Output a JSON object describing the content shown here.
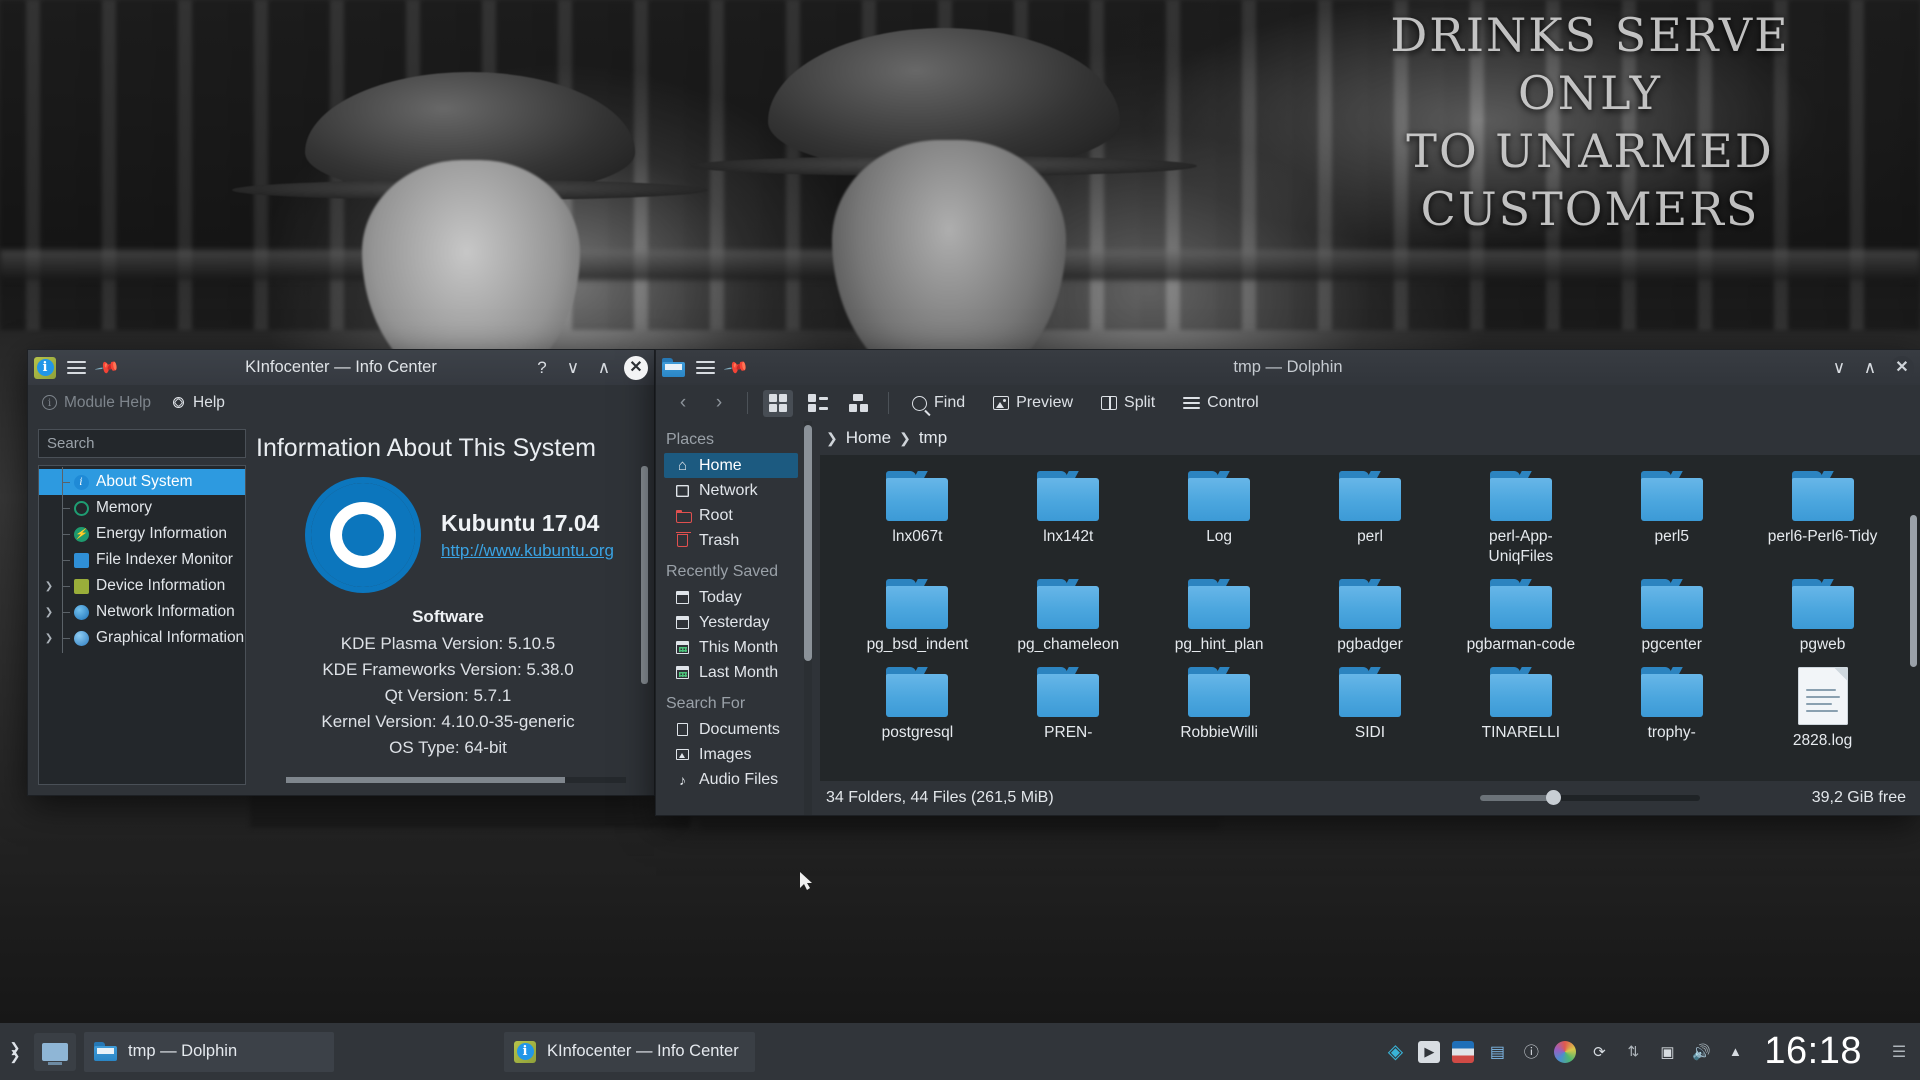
{
  "desktop": {
    "wallpaper_text": "DRINKS SERVED ONLY TO UNARMED CUSTOMERS",
    "wallpaper_lines": [
      "DRINKS SERVE",
      "ONLY",
      "TO UNARMED",
      "CUSTOMERS"
    ]
  },
  "kinfocenter": {
    "title": "KInfocenter — Info Center",
    "app_icon": "info-icon",
    "titlebar_buttons": {
      "menu": "hamburger-icon",
      "pin": "pin-icon",
      "help": "?",
      "minimize": "∨",
      "maximize": "∧",
      "close": "✕"
    },
    "toolbar": {
      "module_help": "Module Help",
      "help": "Help"
    },
    "search": {
      "placeholder": "Search",
      "value": ""
    },
    "tree": [
      {
        "label": "About System",
        "icon": "info-icon",
        "selected": true,
        "expandable": false
      },
      {
        "label": "Memory",
        "icon": "memory-icon",
        "selected": false,
        "expandable": false
      },
      {
        "label": "Energy Information",
        "icon": "energy-icon",
        "selected": false,
        "expandable": false
      },
      {
        "label": "File Indexer Monitor",
        "icon": "file-indexer-icon",
        "selected": false,
        "expandable": false
      },
      {
        "label": "Device Information",
        "icon": "device-icon",
        "selected": false,
        "expandable": true
      },
      {
        "label": "Network Information",
        "icon": "network-icon",
        "selected": false,
        "expandable": true
      },
      {
        "label": "Graphical Information",
        "icon": "graphics-icon",
        "selected": false,
        "expandable": true
      }
    ],
    "content": {
      "heading": "Information About This System",
      "distro": "Kubuntu 17.04",
      "url": "http://www.kubuntu.org",
      "software_heading": "Software",
      "rows": [
        "KDE Plasma Version: 5.10.5",
        "KDE Frameworks Version: 5.38.0",
        "Qt Version: 5.7.1",
        "Kernel Version: 4.10.0-35-generic",
        "OS Type: 64-bit"
      ]
    }
  },
  "dolphin": {
    "title": "tmp — Dolphin",
    "app_icon": "folder-icon",
    "titlebar_buttons": {
      "menu": "hamburger-icon",
      "pin": "pin-icon",
      "minimize": "∨",
      "maximize": "∧",
      "close": "✕"
    },
    "toolbar": {
      "back": "‹",
      "forward": "›",
      "view_icons": "view-icons",
      "view_compact": "view-compact",
      "view_details": "view-details",
      "find": "Find",
      "preview": "Preview",
      "split": "Split",
      "control": "Control"
    },
    "breadcrumb": [
      "Home",
      "tmp"
    ],
    "places": {
      "sections": [
        {
          "title": "Places",
          "items": [
            {
              "label": "Home",
              "icon": "home-icon",
              "selected": true
            },
            {
              "label": "Network",
              "icon": "network-icon",
              "selected": false
            },
            {
              "label": "Root",
              "icon": "root-folder-icon",
              "selected": false
            },
            {
              "label": "Trash",
              "icon": "trash-icon",
              "selected": false
            }
          ]
        },
        {
          "title": "Recently Saved",
          "items": [
            {
              "label": "Today",
              "icon": "calendar-icon",
              "selected": false
            },
            {
              "label": "Yesterday",
              "icon": "calendar-icon",
              "selected": false
            },
            {
              "label": "This Month",
              "icon": "calendar-green-icon",
              "selected": false
            },
            {
              "label": "Last Month",
              "icon": "calendar-green-icon",
              "selected": false
            }
          ]
        },
        {
          "title": "Search For",
          "items": [
            {
              "label": "Documents",
              "icon": "document-icon",
              "selected": false
            },
            {
              "label": "Images",
              "icon": "image-icon",
              "selected": false
            },
            {
              "label": "Audio Files",
              "icon": "audio-icon",
              "selected": false
            }
          ]
        }
      ]
    },
    "files": [
      {
        "name": "lnx067t",
        "type": "folder"
      },
      {
        "name": "lnx142t",
        "type": "folder"
      },
      {
        "name": "Log",
        "type": "folder"
      },
      {
        "name": "perl",
        "type": "folder"
      },
      {
        "name": "perl-App-UniqFiles",
        "type": "folder"
      },
      {
        "name": "perl5",
        "type": "folder"
      },
      {
        "name": "perl6-Perl6-Tidy",
        "type": "folder"
      },
      {
        "name": "pg_bsd_indent",
        "type": "folder"
      },
      {
        "name": "pg_chameleon",
        "type": "folder"
      },
      {
        "name": "pg_hint_plan",
        "type": "folder"
      },
      {
        "name": "pgbadger",
        "type": "folder"
      },
      {
        "name": "pgbarman-code",
        "type": "folder"
      },
      {
        "name": "pgcenter",
        "type": "folder"
      },
      {
        "name": "pgweb",
        "type": "folder"
      },
      {
        "name": "postgresql",
        "type": "folder"
      },
      {
        "name": "PREN-",
        "type": "folder"
      },
      {
        "name": "RobbieWilli",
        "type": "folder"
      },
      {
        "name": "SIDI",
        "type": "folder"
      },
      {
        "name": "TINARELLI",
        "type": "folder"
      },
      {
        "name": "trophy-",
        "type": "folder"
      },
      {
        "name": "2828.log",
        "type": "file"
      }
    ],
    "status": {
      "summary": "34 Folders, 44 Files (261,5 MiB)",
      "free_space": "39,2 GiB free",
      "zoom_percent": 30
    }
  },
  "panel": {
    "launcher_icon": "application-launcher-icon",
    "show_desktop_icon": "show-desktop-icon",
    "tasks": [
      {
        "label": "tmp — Dolphin",
        "icon": "folder-icon"
      },
      {
        "label": "KInfocenter — Info Center",
        "icon": "info-icon"
      }
    ],
    "tray": [
      "clipboard-icon",
      "arrow-right-icon",
      "keyboard-layout-icon",
      "notes-icon",
      "info-icon",
      "color-wheel-icon",
      "updates-icon",
      "network-icon",
      "device-icon",
      "volume-icon",
      "show-hidden-icon"
    ],
    "clock": "16:18"
  },
  "colors": {
    "accent": "#2d9ae0",
    "window_bg": "#2f3338",
    "view_bg": "#232729",
    "folder_blue": "#4ba6de",
    "places_selected": "#1c5a80",
    "link": "#3aa3e3",
    "kubuntu_blue": "#0c76bd"
  }
}
